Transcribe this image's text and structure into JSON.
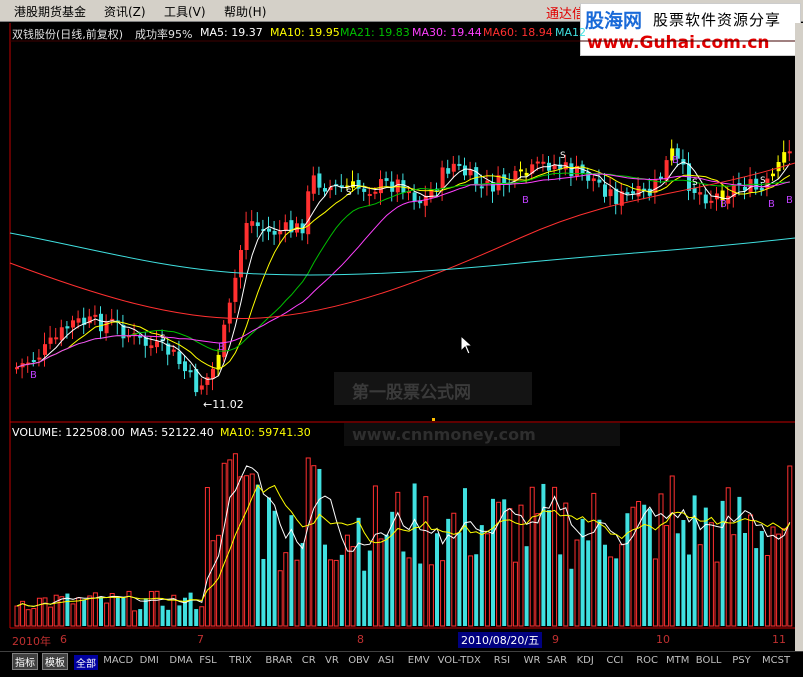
{
  "menu": {
    "items": [
      "港股期货基金",
      "资讯(Z)",
      "工具(V)",
      "帮助(H)"
    ],
    "app_link": "通达信"
  },
  "logo": {
    "main": "股海网",
    "tagline": "股票软件资源分享",
    "url": "www.Guhai.com.cn"
  },
  "price_panel": {
    "title": "双钱股份(日线,前复权)",
    "success_rate": "成功率95%",
    "ma": [
      {
        "label": "MA5: 19.37",
        "color": "#ffffff"
      },
      {
        "label": "MA10: 19.95",
        "color": "#ffff00"
      },
      {
        "label": "MA21: 19.83",
        "color": "#00c000"
      },
      {
        "label": "MA30: 19.44",
        "color": "#ff40ff"
      },
      {
        "label": "MA60: 18.94",
        "color": "#ff3030"
      },
      {
        "label": "MA12",
        "color": "#40e0e0"
      }
    ],
    "low_marker": "←11.02",
    "buy_marker": "B",
    "sell_marker": "S",
    "watermark": "第一股票公式网",
    "watermark_url": "www.cnnmoney.com"
  },
  "volume_panel": {
    "labels": [
      {
        "text": "VOLUME: 122508.00",
        "color": "#ffffff"
      },
      {
        "text": "MA5: 52122.40",
        "color": "#ffffff"
      },
      {
        "text": "MA10: 59741.30",
        "color": "#ffff00"
      }
    ]
  },
  "date_axis": {
    "year_label": "2010年",
    "months": [
      "6",
      "7",
      "8",
      "9",
      "10",
      "11"
    ],
    "cursor_date": "2010/08/20/五"
  },
  "colors": {
    "up": "#ff3030",
    "down": "#40e0e0",
    "signal": "#ffff00",
    "background": "#000000",
    "axis": "#c00000"
  },
  "tabs": {
    "buttons": [
      "指标",
      "模板"
    ],
    "items": [
      "全部",
      "MACD",
      "DMI",
      "DMA",
      "FSL",
      "TRIX",
      "BRAR",
      "CR",
      "VR",
      "OBV",
      "ASI",
      "EMV",
      "VOL-TDX",
      "RSI",
      "WR",
      "SAR",
      "KDJ",
      "CCI",
      "ROC",
      "MTM",
      "BOLL",
      "PSY",
      "MCST"
    ],
    "active": "全部"
  }
}
